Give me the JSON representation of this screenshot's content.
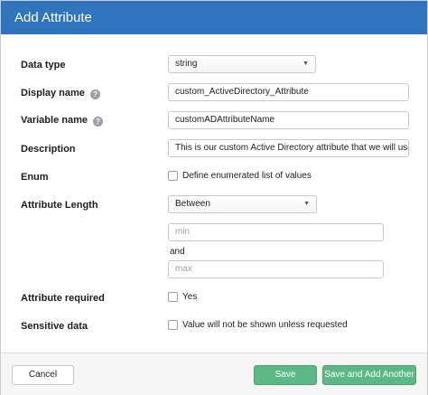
{
  "dialog": {
    "title": "Add Attribute"
  },
  "form": {
    "data_type": {
      "label": "Data type",
      "value": "string"
    },
    "display_name": {
      "label": "Display name",
      "help": "?",
      "value": "custom_ActiveDirectory_Attribute"
    },
    "variable_name": {
      "label": "Variable name",
      "help": "?",
      "value": "customADAttributeName"
    },
    "description": {
      "label": "Description",
      "value": "This is our custom Active Directory attribute that we will use whe"
    },
    "enum": {
      "label": "Enum",
      "checkbox_label": "Define enumerated list of values",
      "checked": false
    },
    "attribute_length": {
      "label": "Attribute Length",
      "value": "Between",
      "min_placeholder": "min",
      "and_text": "and",
      "max_placeholder": "max"
    },
    "attribute_required": {
      "label": "Attribute required",
      "checkbox_label": "Yes",
      "checked": false
    },
    "sensitive_data": {
      "label": "Sensitive data",
      "checkbox_label": "Value will not be shown unless requested",
      "checked": false
    }
  },
  "footer": {
    "cancel_label": "Cancel",
    "save_label": "Save",
    "save_add_label": "Save and Add Another"
  },
  "colors": {
    "header": "#2f74bd",
    "primary_button": "#5cb887"
  },
  "icons": {
    "select_arrow": "chevron-down-icon",
    "help": "help-icon"
  }
}
